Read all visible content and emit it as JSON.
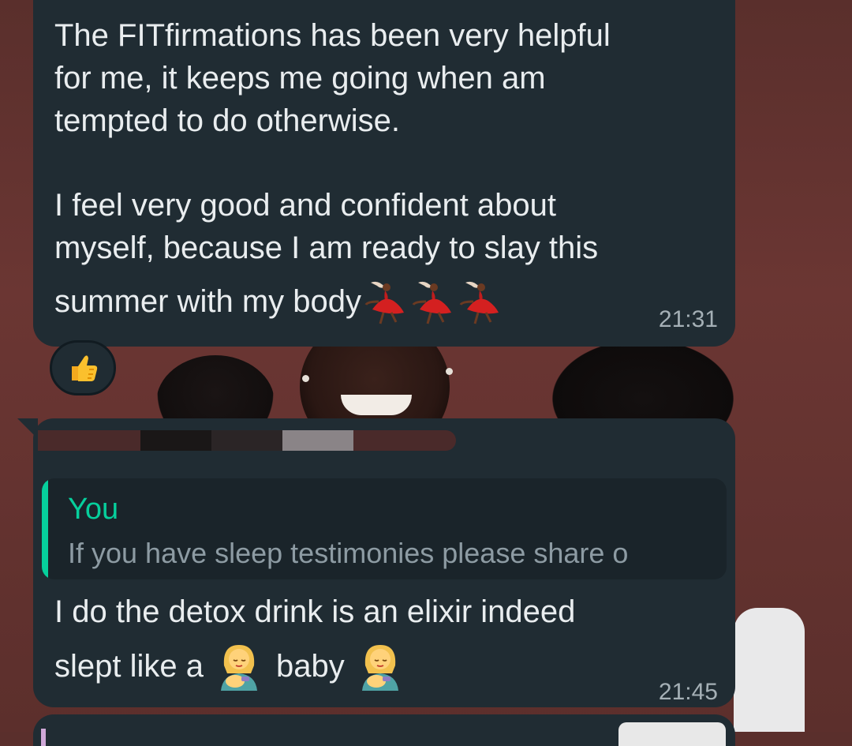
{
  "chat": {
    "messages": [
      {
        "paragraph_1": "The FITfirmations has been very helpful\nfor me, it keeps me going when am\ntempted to do otherwise.",
        "paragraph_2": "I feel very good and confident about\nmyself, because I am ready to slay this",
        "line_3_text": "summer with my body",
        "emoji": "dancer-icon",
        "emoji_count": 3,
        "time": "21:31",
        "reaction": "thumbs-up-icon"
      },
      {
        "sender_redacted": true,
        "quoted_reply": {
          "author": "You",
          "text": "If you have sleep testimonies please share o"
        },
        "line_1": "I do the detox drink is an elixir indeed",
        "line_2_part_1": "slept like a",
        "line_2_part_2": "baby",
        "emoji": "woman-feeding-baby-icon",
        "time": "21:45"
      }
    ]
  },
  "colors": {
    "bubble": "#202c33",
    "quote_accent": "#06cf9c",
    "timestamp": "#a5b0b6"
  }
}
